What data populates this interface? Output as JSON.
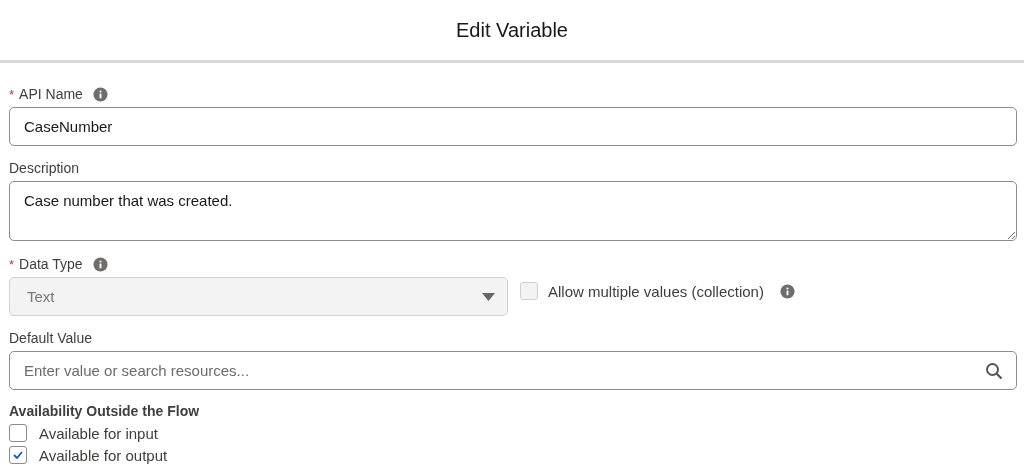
{
  "title": "Edit Variable",
  "api_name": {
    "label": "API Name",
    "required_mark": "*",
    "info": true,
    "value": "CaseNumber"
  },
  "description": {
    "label": "Description",
    "value": "Case number that was created."
  },
  "data_type": {
    "label": "Data Type",
    "required_mark": "*",
    "info": true,
    "value": "Text",
    "disabled": true
  },
  "collection": {
    "label": "Allow multiple values (collection)",
    "checked": false,
    "disabled": true,
    "info": true
  },
  "default_value": {
    "label": "Default Value",
    "placeholder": "Enter value or search resources..."
  },
  "availability": {
    "heading": "Availability Outside the Flow",
    "options": [
      {
        "label": "Available for input",
        "checked": false
      },
      {
        "label": "Available for output",
        "checked": true
      }
    ]
  }
}
